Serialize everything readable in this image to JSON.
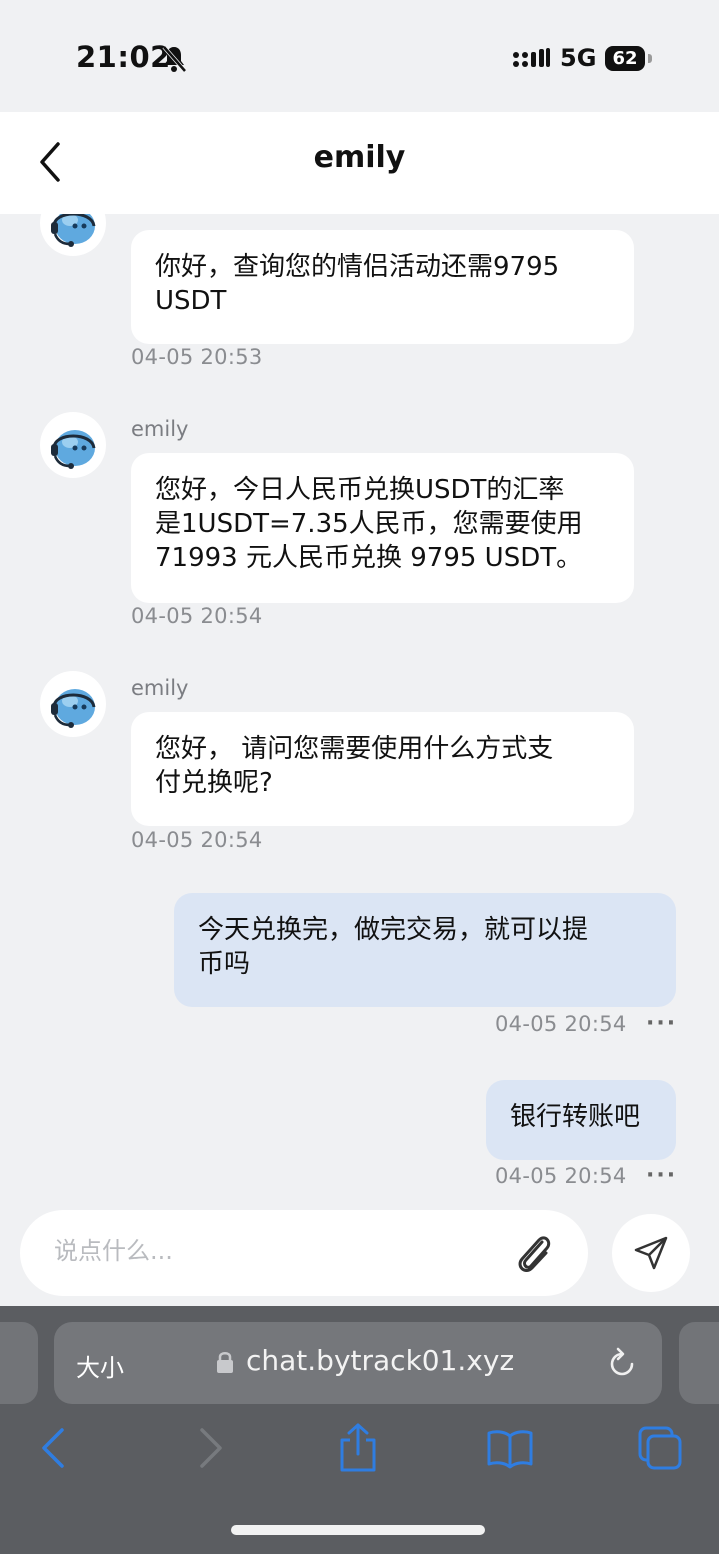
{
  "status": {
    "time": "21:02",
    "network": "5G",
    "battery": "62"
  },
  "chat": {
    "title": "emily"
  },
  "messages": [
    {
      "sender": "",
      "text_lines": [
        "你好，查询您的情侣活动还需9795",
        "USDT"
      ],
      "time": "04-05 20:53"
    },
    {
      "sender": "emily",
      "text_lines": [
        "您好，今日人民币兑换USDT的汇率",
        "是1USDT=7.35人民币，您需要使用",
        "71993 元人民币兑换 9795  USDT。"
      ],
      "time": "04-05 20:54"
    },
    {
      "sender": "emily",
      "text_lines": [
        "您好， 请问您需要使用什么方式支",
        "付兑换呢?"
      ],
      "time": "04-05 20:54"
    },
    {
      "sender": "",
      "text_lines": [
        "今天兑换完，做完交易，就可以提",
        "币吗"
      ],
      "time": "04-05 20:54",
      "more": "···"
    },
    {
      "sender": "",
      "text_lines": [
        "银行转账吧"
      ],
      "time": "04-05 20:54",
      "more": "···"
    }
  ],
  "composer": {
    "placeholder": "说点什么..."
  },
  "browser": {
    "text_size": "大小",
    "url": "chat.bytrack01.xyz"
  },
  "colors": {
    "incoming_bubble": "#ffffff",
    "outgoing_bubble": "#dbe5f4",
    "toolbar_accent": "#2f7de1"
  }
}
